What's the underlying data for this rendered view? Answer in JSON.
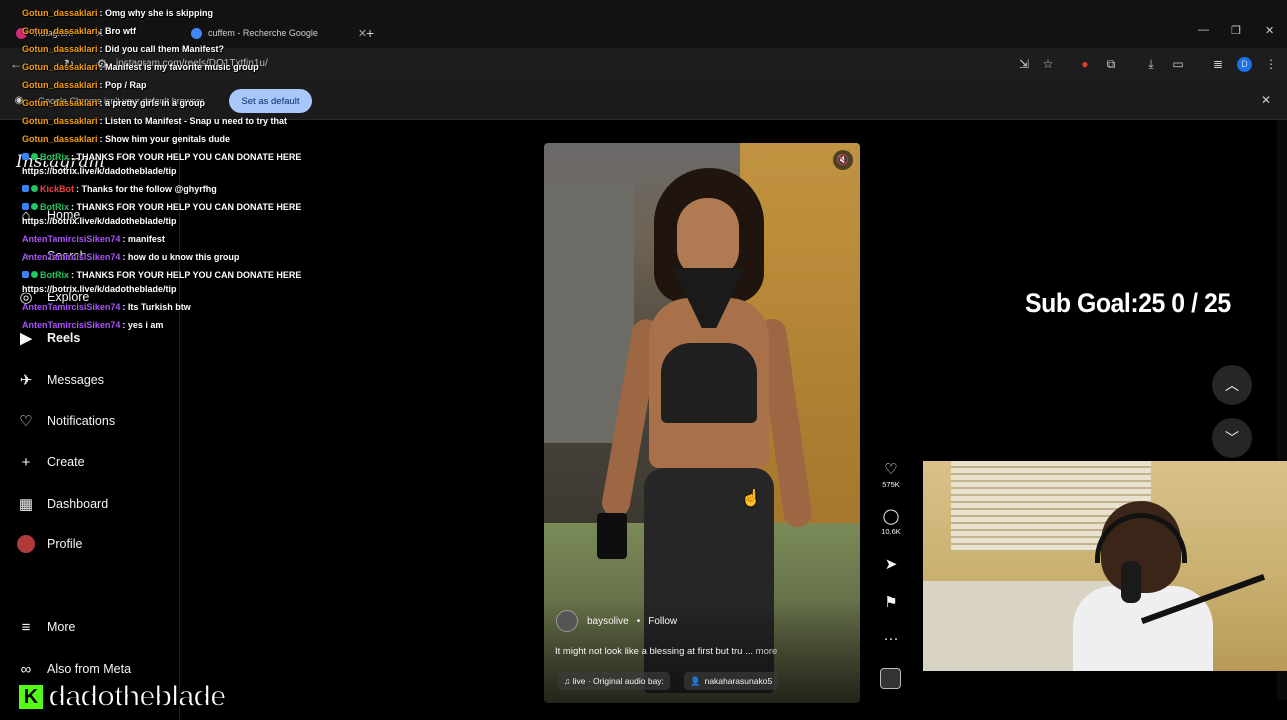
{
  "browser": {
    "tabs": [
      {
        "label": "Instagram",
        "active": true
      },
      {
        "label": "cuffem - Recherche Google",
        "active": false
      }
    ],
    "new_tab": "+",
    "url": "instagram.com/reels/DO1Txtfin1u/",
    "profile_initial": "D",
    "infobar": {
      "text": "Google Chrome isn't your default browser",
      "button": "Set as default"
    }
  },
  "sidebar": {
    "logo": "Instagram",
    "items": [
      {
        "label": "Home",
        "icon": "home-icon",
        "glyph": "⌂"
      },
      {
        "label": "Search",
        "icon": "search-icon",
        "glyph": "⌕"
      },
      {
        "label": "Explore",
        "icon": "explore-icon",
        "glyph": "◎"
      },
      {
        "label": "Reels",
        "icon": "reels-icon",
        "glyph": "▶",
        "active": true
      },
      {
        "label": "Messages",
        "icon": "messages-icon",
        "glyph": "✈"
      },
      {
        "label": "Notifications",
        "icon": "heart-icon",
        "glyph": "♡"
      },
      {
        "label": "Create",
        "icon": "plus-icon",
        "glyph": "+"
      },
      {
        "label": "Dashboard",
        "icon": "dashboard-icon",
        "glyph": "▦"
      },
      {
        "label": "Profile",
        "icon": "avatar",
        "glyph": ""
      },
      {
        "label": "More",
        "icon": "menu-icon",
        "glyph": "≡"
      },
      {
        "label": "Also from Meta",
        "icon": "meta-icon",
        "glyph": "∞"
      }
    ]
  },
  "reel": {
    "author": "baysolive",
    "dot": "•",
    "follow": "Follow",
    "caption": "It might not look like a blessing at first but tru ...",
    "more": "more",
    "audio": "♫ live · Original audio  bay:",
    "tagged": "nakaharasunako5",
    "likes": "575K",
    "comments": "10.6K"
  },
  "overlay": {
    "subgoal": "Sub Goal:25  0 / 25",
    "brand": "dadotheblade",
    "brand_badge": "K"
  },
  "chat": [
    {
      "user": "Gotun_dassaklari",
      "text": ": Omg why she is skipping",
      "color": "#f59e0b"
    },
    {
      "user": "Gotun_dassaklari",
      "text": ": Bro wtf",
      "color": "#f59e0b"
    },
    {
      "user": "Gotun_dassaklari",
      "text": ": Did you call them Manifest?",
      "color": "#f59e0b"
    },
    {
      "user": "Gotun_dassaklari",
      "text": ": Manifest is my favorite music group",
      "color": "#f59e0b"
    },
    {
      "user": "Gotun_dassaklari",
      "text": ": Pop / Rap",
      "color": "#f59e0b"
    },
    {
      "user": "Gotun_dassaklari",
      "text": ": a pretty girls in a group",
      "color": "#f59e0b"
    },
    {
      "user": "Gotun_dassaklari",
      "text": ": Listen to Manifest - Snap u need to try that",
      "color": "#f59e0b"
    },
    {
      "user": "Gotun_dassaklari",
      "text": ": Show him your genitals dude",
      "color": "#f59e0b"
    },
    {
      "user": "BotRix",
      "text": ": THANKS FOR YOUR HELP YOU CAN DONATE HERE",
      "color": "#22c55e",
      "badges": true
    },
    {
      "user": "",
      "text": "https://botrix.live/k/dadotheblade/tip",
      "color": "#ffffff"
    },
    {
      "user": "KickBot",
      "text": ": Thanks for the follow @ghyrfhg",
      "color": "#ef4444",
      "badges": true
    },
    {
      "user": "BotRix",
      "text": ": THANKS FOR YOUR HELP YOU CAN DONATE HERE",
      "color": "#22c55e",
      "badges": true
    },
    {
      "user": "",
      "text": "https://botrix.live/k/dadotheblade/tip",
      "color": "#ffffff"
    },
    {
      "user": "AntenTamircisiSiken74",
      "text": ": manifest",
      "color": "#a855f7"
    },
    {
      "user": "AntenTamircisiSiken74",
      "text": ": how do u know this group",
      "color": "#a855f7"
    },
    {
      "user": "BotRix",
      "text": ": THANKS FOR YOUR HELP YOU CAN DONATE HERE",
      "color": "#22c55e",
      "badges": true
    },
    {
      "user": "",
      "text": "https://botrix.live/k/dadotheblade/tip",
      "color": "#ffffff"
    },
    {
      "user": "AntenTamircisiSiken74",
      "text": ": Its Turkish btw",
      "color": "#a855f7"
    },
    {
      "user": "AntenTamircisiSiken74",
      "text": ": yes i am",
      "color": "#a855f7"
    }
  ]
}
